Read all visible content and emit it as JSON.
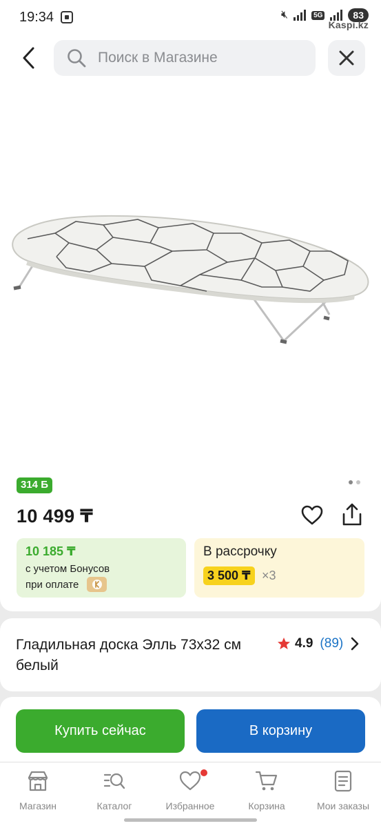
{
  "status_bar": {
    "time": "19:34",
    "network": "5G",
    "battery": "83",
    "watermark": "Kaspi.kz"
  },
  "header": {
    "search_placeholder": "Поиск в Магазине"
  },
  "product": {
    "bonus_badge": "314 Б",
    "price": "10 499 ₸",
    "image_count": 2,
    "active_image": 1,
    "bonus_offer": {
      "price": "10 185 ₸",
      "line1": "с учетом Бонусов",
      "line2": "при оплате"
    },
    "installment": {
      "title": "В рассрочку",
      "amount": "3 500 ₸",
      "multiplier": "×3"
    },
    "title": "Гладильная доска Элль 73x32 см белый",
    "rating": "4.9",
    "reviews": "(89)"
  },
  "actions": {
    "buy_now": "Купить сейчас",
    "add_to_cart": "В корзину"
  },
  "bottom_nav": {
    "items": [
      {
        "label": "Магазин",
        "icon": "shop-icon"
      },
      {
        "label": "Каталог",
        "icon": "catalog-icon"
      },
      {
        "label": "Избранное",
        "icon": "heart-icon"
      },
      {
        "label": "Корзина",
        "icon": "cart-icon"
      },
      {
        "label": "Мои заказы",
        "icon": "orders-icon"
      }
    ]
  },
  "colors": {
    "green": "#3bab2e",
    "blue": "#1a6ac4",
    "yellow": "#f7d21d",
    "rating_star": "#e53935"
  }
}
